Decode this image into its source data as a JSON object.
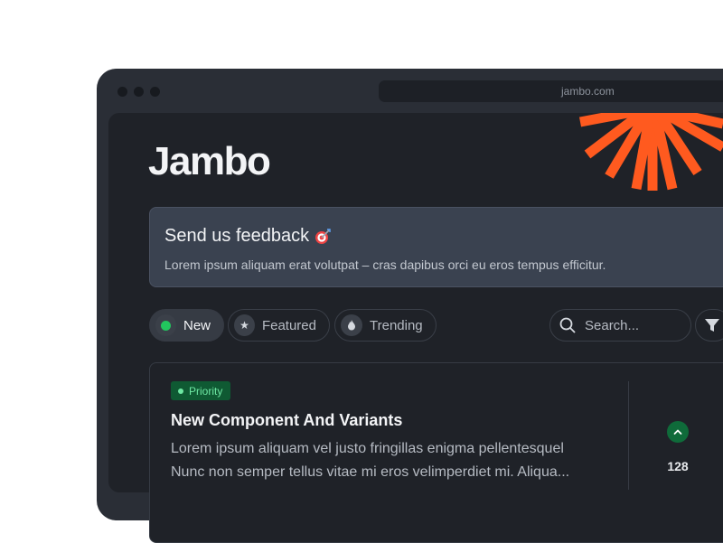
{
  "browser": {
    "url": "jambo.com"
  },
  "brand": {
    "name": "Jambo",
    "accent": "#ff5a1f"
  },
  "feedback": {
    "title": "Send us feedback",
    "emoji_icon": "target-dart-icon",
    "text": "Lorem ipsum aliquam erat volutpat – cras dapibus orci eu eros tempus efficitur."
  },
  "filters": {
    "tabs": [
      {
        "label": "New",
        "icon": "dot-icon",
        "active": true
      },
      {
        "label": "Featured",
        "icon": "star-icon",
        "active": false
      },
      {
        "label": "Trending",
        "icon": "flame-icon",
        "active": false
      }
    ],
    "search_placeholder": "Search...",
    "filter_icon": "funnel-icon"
  },
  "post": {
    "badge": "Priority",
    "title": "New Component And Variants",
    "description_line1": "Lorem ipsum aliquam vel justo fringillas enigma pellentesquel",
    "description_line2": "Nunc non semper tellus vitae mi eros velimperdiet mi. Aliqua...",
    "votes": "128"
  },
  "colors": {
    "success": "#0f6b3a",
    "badge_text": "#6ee7a3",
    "live_dot": "#22c55e"
  }
}
